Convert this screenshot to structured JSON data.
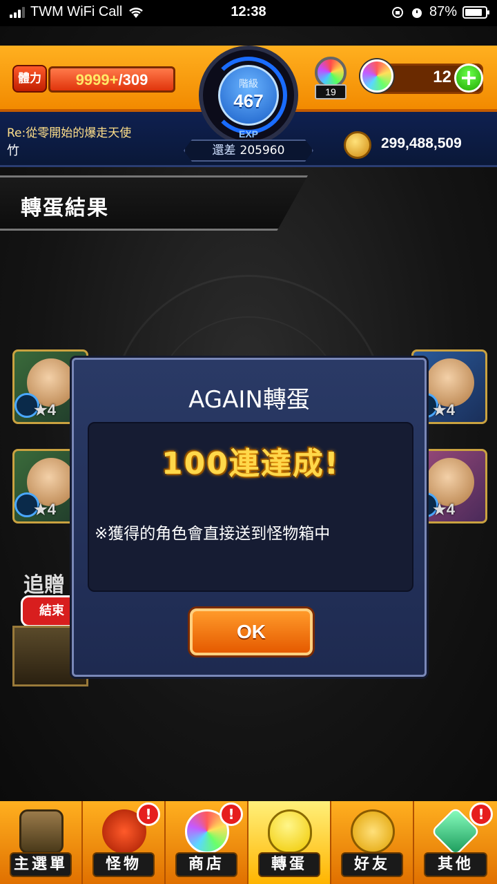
{
  "status_bar": {
    "carrier": "TWM WiFi Call",
    "time": "12:38",
    "battery_percent": "87%",
    "battery_level": 0.87
  },
  "header": {
    "stamina_label": "體力",
    "stamina_current": "9999+",
    "stamina_max": "/309",
    "rank_label": "階級",
    "rank_value": "467",
    "exp_label": "EXP",
    "exp_remaining_label": "還差",
    "exp_remaining": "205960",
    "keys_count": "19",
    "orb_count": "12",
    "quest_title": "Re:從零開始的爆走天使",
    "quest_subtitle": "竹",
    "coins": "299,488,509"
  },
  "banner": {
    "title": "轉蛋結果"
  },
  "background_cards": {
    "star_text": "★4",
    "bonus_label": "追贈",
    "bonus_tag": "結束"
  },
  "dialog": {
    "title": "AGAIN轉蛋",
    "headline": "100連達成!",
    "note": "※獲得的角色會直接送到怪物箱中",
    "ok_label": "OK"
  },
  "nav": {
    "items": [
      {
        "label": "主選單",
        "icon": "home-gate-icon",
        "badge": ""
      },
      {
        "label": "怪物",
        "icon": "monster-icon",
        "badge": "!"
      },
      {
        "label": "商店",
        "icon": "rainbow-orb-icon",
        "badge": "!"
      },
      {
        "label": "轉蛋",
        "icon": "egg-icon",
        "badge": ""
      },
      {
        "label": "好友",
        "icon": "friends-icon",
        "badge": ""
      },
      {
        "label": "其他",
        "icon": "other-icon",
        "badge": "!"
      }
    ],
    "active_index": 3
  },
  "colors": {
    "header_orange": "#f7a000",
    "header_navy": "#0f2050",
    "dialog_bg": "#26345c",
    "ok_orange": "#ee6a00",
    "headline_gold": "#ffd84a"
  }
}
